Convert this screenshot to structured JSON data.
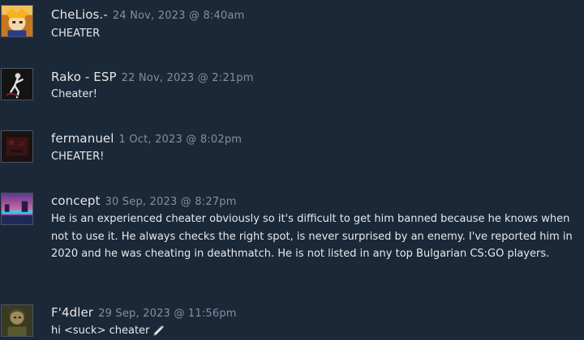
{
  "comments": [
    {
      "author": "CheLios.-",
      "timestamp": "24 Nov, 2023 @ 8:40am",
      "text": "CHEATER",
      "avatar_icon": "orange-character-avatar"
    },
    {
      "author": "Rako - ESP",
      "timestamp": "22 Nov, 2023 @ 2:21pm",
      "text": "Cheater!",
      "avatar_icon": "dark-figure-avatar"
    },
    {
      "author": "fermanuel",
      "timestamp": "1 Oct, 2023 @ 8:02pm",
      "text": "CHEATER!",
      "avatar_icon": "dark-red-avatar"
    },
    {
      "author": "concept",
      "timestamp": "30 Sep, 2023 @ 8:27pm",
      "text": "He is an experienced cheater obviously so it's difficult to get him banned because he knows when not to use it. He always checks the right spot, is never surprised by an enemy. I've reported him in 2020 and he was cheating in deathmatch. He is not listed in any top Bulgarian CS:GO players.",
      "avatar_icon": "neon-landscape-avatar"
    },
    {
      "author": "F'4dler",
      "timestamp": "29 Sep, 2023 @ 11:56pm",
      "text": "hi <suck> cheater",
      "avatar_icon": "soldier-avatar",
      "emoticon": "pen-emoticon-icon"
    }
  ],
  "colors": {
    "background": "#1b2838",
    "author": "#e6e6e6",
    "timestamp": "#8091a2",
    "text": "#e6e9ec"
  }
}
